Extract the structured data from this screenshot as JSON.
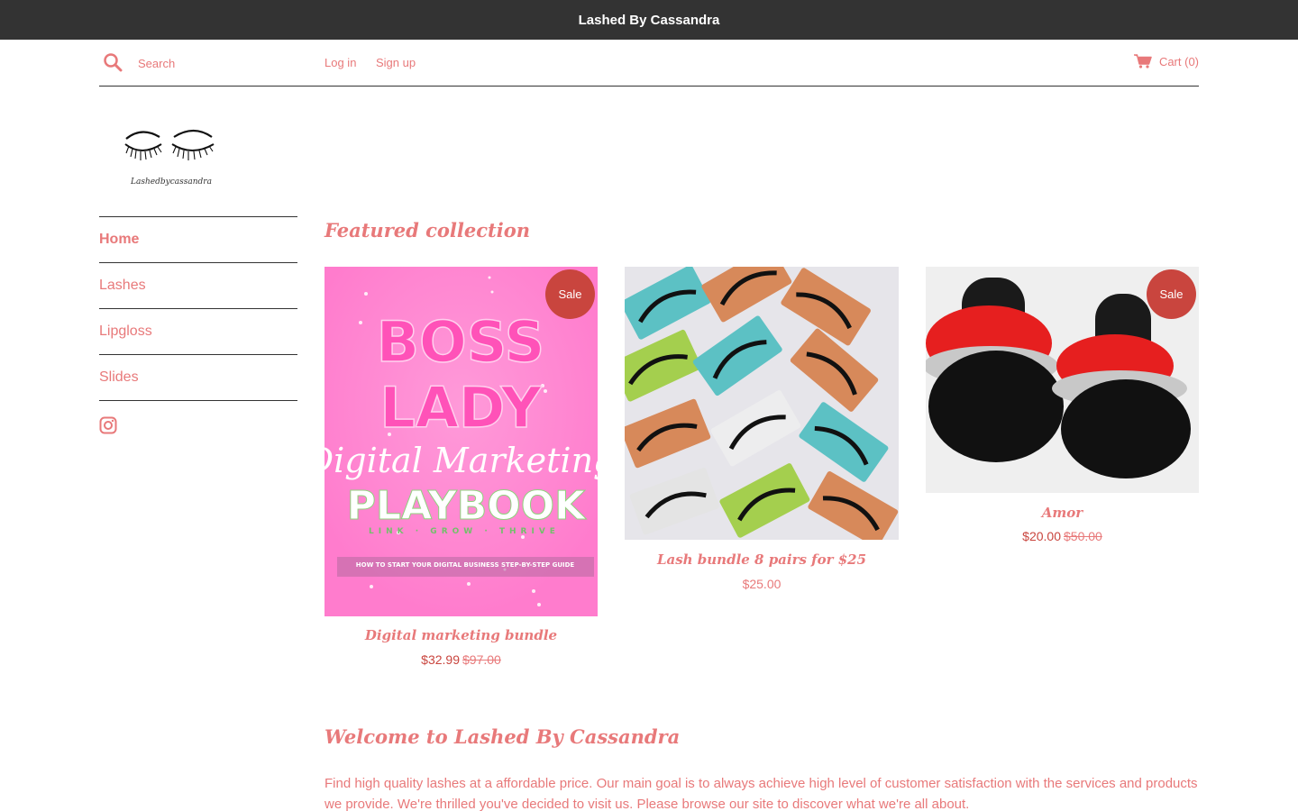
{
  "announcement": "Lashed By Cassandra",
  "header": {
    "search_placeholder": "Search",
    "login": "Log in",
    "signup": "Sign up",
    "cart": "Cart (0)"
  },
  "logo_text": "Lashedbycassandra",
  "sidebar": {
    "items": [
      {
        "label": "Home"
      },
      {
        "label": "Lashes"
      },
      {
        "label": "Lipgloss"
      },
      {
        "label": "Slides"
      }
    ]
  },
  "featured": {
    "title": "Featured collection",
    "products": [
      {
        "name": "Digital marketing bundle",
        "price": "$32.99",
        "compare": "$97.00",
        "badge": "Sale",
        "image_text": {
          "line1": "BOSS",
          "line2": "LADY",
          "script": "Digital Marketing",
          "line3": "PLAYBOOK",
          "tagline": "LINK · GROW · THRIVE",
          "footer": "HOW TO START YOUR DIGITAL BUSINESS STEP-BY-STEP GUIDE"
        }
      },
      {
        "name": "Lash bundle 8 pairs for $25",
        "price": "$25.00"
      },
      {
        "name": "Amor",
        "price": "$20.00",
        "compare": "$50.00",
        "badge": "Sale"
      }
    ]
  },
  "welcome": {
    "title": "Welcome to Lashed By Cassandra",
    "text": "Find high quality lashes at a affordable price. Our main goal is to always achieve high level of customer satisfaction with the services and products we provide. We're thrilled you've decided to visit us. Please browse our site to discover what we're all about."
  },
  "colors": {
    "accent": "#e8797a",
    "sale": "#c9453e",
    "announcement_bg": "#333333"
  }
}
